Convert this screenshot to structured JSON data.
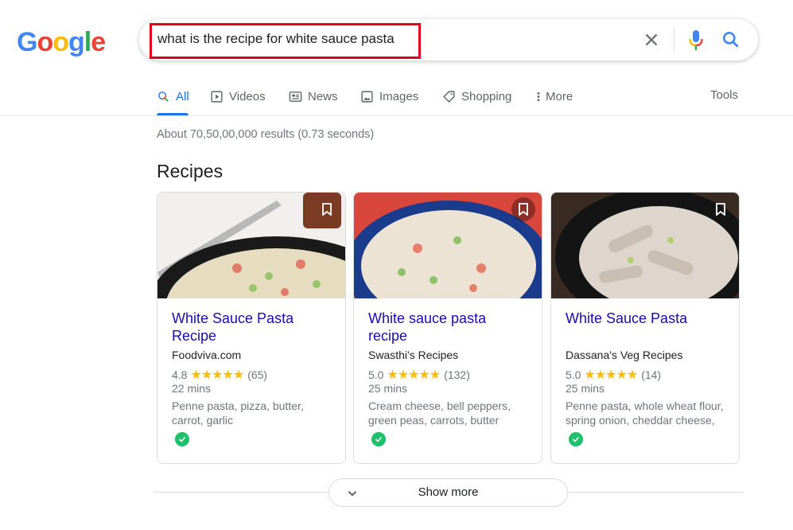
{
  "logo": {
    "letters": [
      "G",
      "o",
      "o",
      "g",
      "l",
      "e"
    ],
    "colors": [
      "#4285f4",
      "#ea4335",
      "#fbbc05",
      "#4285f4",
      "#34a853",
      "#ea4335"
    ]
  },
  "search": {
    "query": "what is the recipe for white sauce pasta",
    "highlight_color": "#e2001a"
  },
  "tabs": [
    {
      "label": "All",
      "icon": "search-icon",
      "active": true
    },
    {
      "label": "Videos",
      "icon": "video-icon",
      "active": false
    },
    {
      "label": "News",
      "icon": "news-icon",
      "active": false
    },
    {
      "label": "Images",
      "icon": "image-icon",
      "active": false
    },
    {
      "label": "Shopping",
      "icon": "tag-icon",
      "active": false
    },
    {
      "label": "More",
      "icon": "more-vert-icon",
      "active": false
    }
  ],
  "tools_label": "Tools",
  "result_stats": "About 70,50,00,000 results (0.73 seconds)",
  "section_title": "Recipes",
  "recipes": [
    {
      "title": "White Sauce Pasta Recipe",
      "source": "Foodviva.com",
      "rating": "4.8",
      "stars": "★★★★★",
      "reviews": "(65)",
      "time": "22 mins",
      "ingredients": "Penne pasta, pizza, butter, carrot, garlic"
    },
    {
      "title": "White sauce pasta recipe",
      "source": "Swasthi's Recipes",
      "rating": "5.0",
      "stars": "★★★★★",
      "reviews": "(132)",
      "time": "25 mins",
      "ingredients": "Cream cheese, bell peppers, green peas, carrots, butter"
    },
    {
      "title": "White Sauce Pasta",
      "source": "Dassana's Veg Recipes",
      "rating": "5.0",
      "stars": "★★★★★",
      "reviews": "(14)",
      "time": "25 mins",
      "ingredients": "Penne pasta, whole wheat flour, spring onion, cheddar cheese,"
    }
  ],
  "show_more_label": "Show more",
  "colors": {
    "link": "#1a0dab",
    "accent": "#1a73e8",
    "star": "#fbbc04",
    "verified": "#1ec06b"
  }
}
